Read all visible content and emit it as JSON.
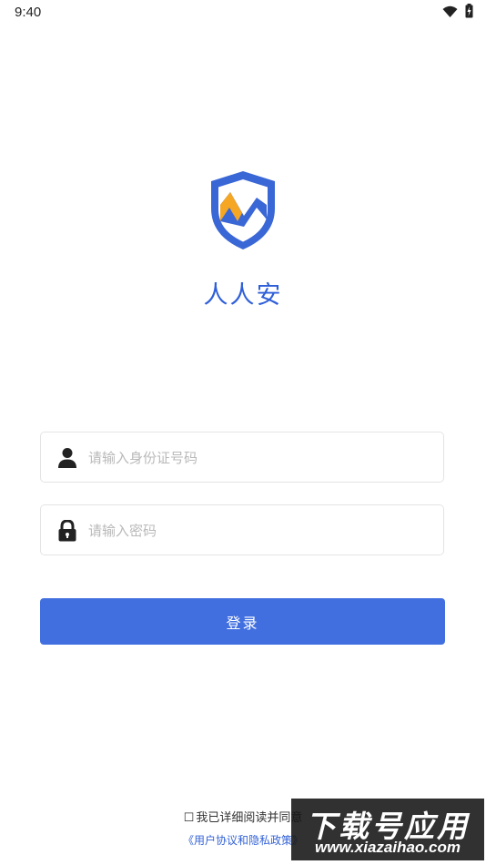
{
  "status_bar": {
    "time": "9:40",
    "icons": [
      "wifi-icon",
      "battery-charging-icon"
    ]
  },
  "app": {
    "name": "人人安",
    "logo_icon": "shield-m-logo",
    "colors": {
      "brand_blue": "#3a67d6",
      "accent_orange": "#f5a623"
    }
  },
  "form": {
    "id_field": {
      "icon": "user-icon",
      "placeholder": "请输入身份证号码",
      "value": ""
    },
    "password_field": {
      "icon": "lock-icon",
      "placeholder": "请输入密码",
      "value": ""
    },
    "login_button": {
      "label": "登录",
      "color": "#416fe0"
    }
  },
  "agreement": {
    "checkbox_symbol": "☐",
    "text": "我已详细阅读并同意",
    "link_text": "《用户协议和隐私政策》"
  },
  "watermark": {
    "title": "下载号应用",
    "url": "www.xiazaihao.com"
  }
}
